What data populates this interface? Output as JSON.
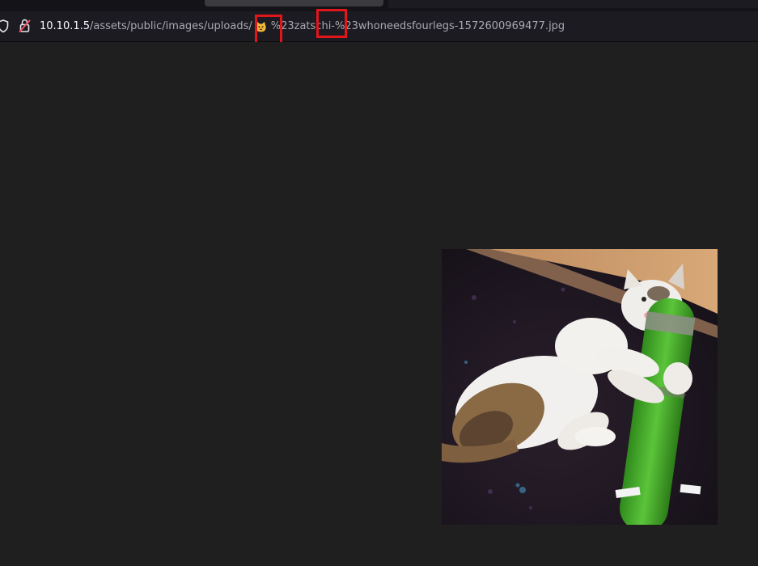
{
  "browser": {
    "url": {
      "host": "10.10.1.5",
      "path_prefix": "/assets/public/images/uploads/",
      "path_rest": "%23zatschi-%23whoneedsfourlegs-1572600969477.jpg",
      "emoji": "cat-face-emoji"
    },
    "annotation_color": "#e0161b"
  },
  "page": {
    "background": "#1f1f1f",
    "image_alt": "cat-hugging-green-toy-photo"
  }
}
